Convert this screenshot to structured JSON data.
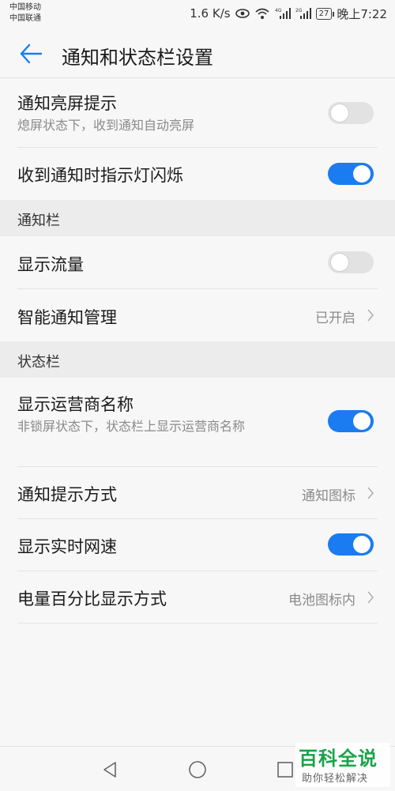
{
  "status_bar": {
    "carrier_1": "中国移动",
    "carrier_2": "中国联通",
    "speed": "1.6 K/s",
    "battery": "27",
    "time": "晚上7:22",
    "icons": [
      "eye-icon",
      "wifi-icon",
      "signal-4g-icon",
      "signal-2g-icon",
      "battery-icon"
    ]
  },
  "app_bar": {
    "title": "通知和状态栏设置",
    "back_icon": "back-arrow-icon",
    "accent": "#1a7cf0"
  },
  "rows": {
    "notify_wake": {
      "label": "通知亮屏提示",
      "sub": "熄屏状态下，收到通知自动亮屏",
      "on": false
    },
    "led_blink": {
      "label": "收到通知时指示灯闪烁",
      "on": true
    },
    "show_traffic": {
      "label": "显示流量",
      "on": false
    },
    "smart_notify": {
      "label": "智能通知管理",
      "value": "已开启"
    },
    "carrier_name": {
      "label": "显示运营商名称",
      "sub": "非锁屏状态下，状态栏上显示运营商名称",
      "on": true
    },
    "notify_style": {
      "label": "通知提示方式",
      "value": "通知图标"
    },
    "net_speed": {
      "label": "显示实时网速",
      "on": true
    },
    "battery_pct": {
      "label": "电量百分比显示方式",
      "value": "电池图标内"
    }
  },
  "sections": {
    "notification_bar": "通知栏",
    "status_bar": "状态栏"
  },
  "watermark": {
    "title": "百科全说",
    "subtitle": "助你轻松解决"
  },
  "nav_bar": {
    "icons": [
      "nav-back-icon",
      "nav-home-icon",
      "nav-recent-icon"
    ]
  }
}
